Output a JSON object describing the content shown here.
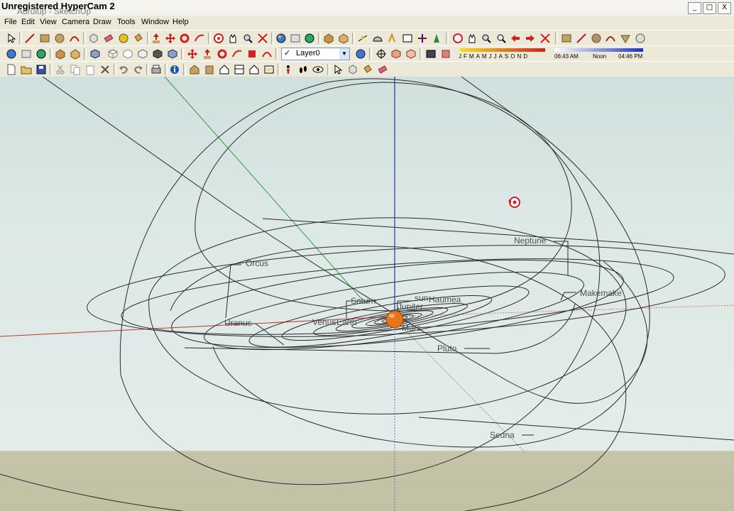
{
  "window": {
    "watermark": "Unregistered HyperCam 2",
    "title_ghost": "Aurulup - SketchUp",
    "buttons": [
      "_",
      "□",
      "X"
    ]
  },
  "menu": [
    "File",
    "Edit",
    "View",
    "Camera",
    "Draw",
    "Tools",
    "Window",
    "Help"
  ],
  "layer": {
    "check": "✓",
    "name": "Layer0"
  },
  "shadows": {
    "months": [
      "J",
      "F",
      "M",
      "A",
      "M",
      "J",
      "J",
      "A",
      "S",
      "O",
      "N",
      "D"
    ],
    "time_left": "06:43 AM",
    "time_mid": "Noon",
    "time_right": "04:46 PM"
  },
  "labels": {
    "neptune": "Neptune",
    "orcus": "Orcus",
    "makemake": "Makemake",
    "saturn": "Saturn",
    "sun": "sun",
    "haumea": "Haumea",
    "jupiter": "Jupiter",
    "uranus": "Uranus",
    "venus": "Venus",
    "earth": "Earth",
    "mars": "Mars",
    "pluto": "Pluto",
    "sedna": "Sedna"
  },
  "colors": {
    "axis_red": "#c0392b",
    "axis_green": "#2e9e3e",
    "axis_blue": "#2030c8",
    "sun": "#e8741a",
    "ground": "#c4c2a5"
  }
}
